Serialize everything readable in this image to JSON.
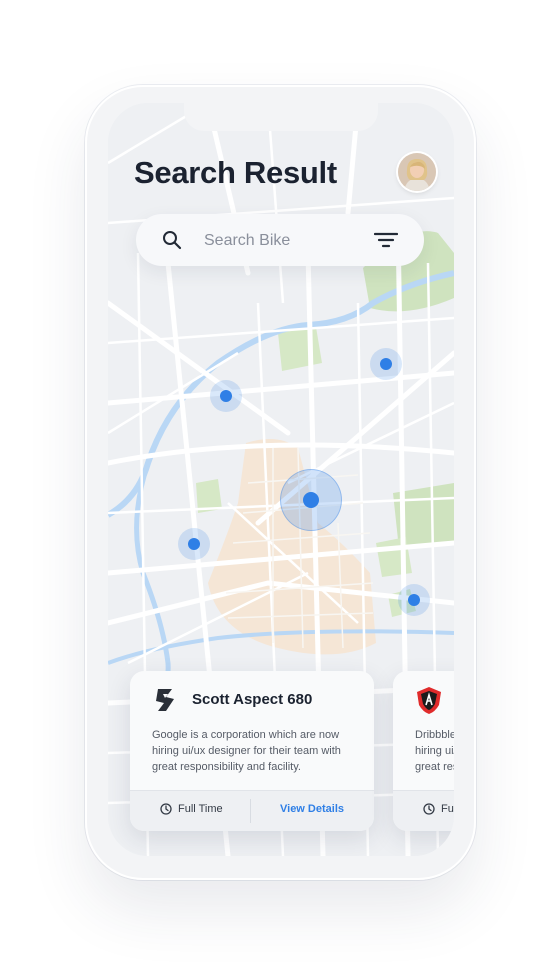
{
  "header": {
    "title": "Search Result"
  },
  "search": {
    "placeholder": "Search Bike"
  },
  "colors": {
    "accent": "#2f7fe6",
    "title": "#1b2230",
    "water": "#b9d7f5",
    "park": "#cfe3bf",
    "zone": "#f5e6d6"
  },
  "icons": [
    "search-icon",
    "filter-icon",
    "clock-icon",
    "avatar"
  ],
  "cards": [
    {
      "name": "Scott Aspect 680",
      "description": "Google is a corporation which are now hiring ui/ux designer for their team with great responsibility and facility.",
      "type": "Full Time",
      "action": "View Details"
    },
    {
      "name": "",
      "description": "Dribbble hiring ui/ great res",
      "type": "Fu",
      "action": ""
    }
  ]
}
